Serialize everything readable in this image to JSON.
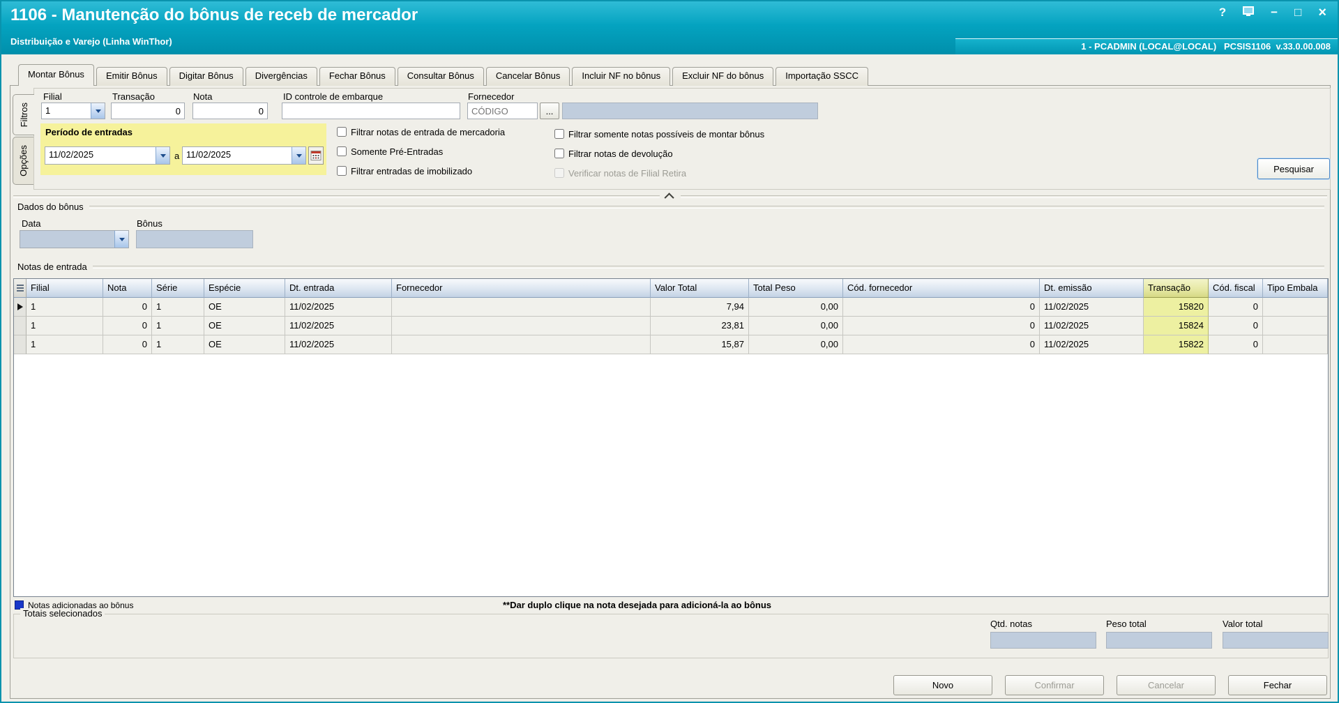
{
  "colors": {
    "titlebar_teal": "#04a3c0",
    "highlight_yellow": "#f6f29b",
    "transacao_yellow": "#edf0a1",
    "legend_blue": "#1837c8",
    "field_readonly_blue": "#c0cddd"
  },
  "window": {
    "title": "1106 - Manutenção do bônus de receb de mercador",
    "subtitle": "Distribuição e Varejo (Linha WinThor)",
    "user_info": "1 - PCADMIN (LOCAL@LOCAL)   PCSIS1106  v.33.0.00.008",
    "controls": {
      "help": "?",
      "minimize": "−",
      "maximize": "□",
      "close": "×"
    }
  },
  "tabs": [
    {
      "label": "Montar Bônus",
      "active": true
    },
    {
      "label": "Emitir Bônus",
      "active": false
    },
    {
      "label": "Digitar Bônus",
      "active": false
    },
    {
      "label": "Divergências",
      "active": false
    },
    {
      "label": "Fechar Bônus",
      "active": false
    },
    {
      "label": "Consultar Bônus",
      "active": false
    },
    {
      "label": "Cancelar Bônus",
      "active": false
    },
    {
      "label": "Incluir NF no bônus",
      "active": false
    },
    {
      "label": "Excluir NF do bônus",
      "active": false
    },
    {
      "label": "Importação SSCC",
      "active": false
    }
  ],
  "side_tabs": [
    {
      "label": "Filtros",
      "active": true
    },
    {
      "label": "Opções",
      "active": false
    }
  ],
  "filters": {
    "filial": {
      "label": "Filial",
      "value": "1"
    },
    "transacao": {
      "label": "Transação",
      "value": "0"
    },
    "nota": {
      "label": "Nota",
      "value": "0"
    },
    "id_embarque": {
      "label": "ID controle de embarque",
      "value": ""
    },
    "fornecedor": {
      "label": "Fornecedor",
      "code_placeholder": "CÓDIGO",
      "browse_label": "...",
      "name_value": ""
    },
    "periodo": {
      "label": "Período de entradas",
      "date_from": "11/02/2025",
      "connector": "a",
      "date_to": "11/02/2025"
    },
    "checkbox_groups": [
      {
        "items": [
          {
            "label": "Filtrar notas de entrada de mercadoria",
            "checked": false
          },
          {
            "label": "Somente Pré-Entradas",
            "checked": false
          },
          {
            "label": "Filtrar entradas de imobilizado",
            "checked": false
          }
        ]
      },
      {
        "items": [
          {
            "label": "Filtrar somente notas possíveis de montar bônus",
            "checked": false
          },
          {
            "label": "Filtrar notas de devolução",
            "checked": false
          },
          {
            "label": "Verificar notas de Filial Retira",
            "checked": false,
            "disabled": true
          }
        ]
      }
    ],
    "search_button": "Pesquisar"
  },
  "bonus_section": {
    "title": "Dados do bônus",
    "data_label": "Data",
    "data_value": "",
    "bonus_label": "Bônus",
    "bonus_value": ""
  },
  "notes": {
    "title": "Notas de entrada",
    "columns": [
      "Filial",
      "Nota",
      "Série",
      "Espécie",
      "Dt. entrada",
      "Fornecedor",
      "Valor Total",
      "Total Peso",
      "Cód. fornecedor",
      "Dt. emissão",
      "Transação",
      "Cód. fiscal",
      "Tipo Embala"
    ],
    "rows": [
      {
        "current": true,
        "cells": [
          "1",
          "0",
          "1",
          "OE",
          "11/02/2025",
          "",
          "7,94",
          "0,00",
          "0",
          "11/02/2025",
          "15820",
          "0",
          ""
        ]
      },
      {
        "current": false,
        "cells": [
          "1",
          "0",
          "1",
          "OE",
          "11/02/2025",
          "",
          "23,81",
          "0,00",
          "0",
          "11/02/2025",
          "15824",
          "0",
          ""
        ]
      },
      {
        "current": false,
        "cells": [
          "1",
          "0",
          "1",
          "OE",
          "11/02/2025",
          "",
          "15,87",
          "0,00",
          "0",
          "11/02/2025",
          "15822",
          "0",
          ""
        ]
      }
    ],
    "legend": "Notas adicionadas ao bônus",
    "hint": "**Dar duplo clique na nota desejada para adicioná-la ao bônus"
  },
  "totals": {
    "title": "Totais selecionados",
    "fields": [
      {
        "label": "Qtd. notas",
        "value": ""
      },
      {
        "label": "Peso total",
        "value": ""
      },
      {
        "label": "Valor total",
        "value": ""
      }
    ]
  },
  "footer_buttons": [
    {
      "label": "Novo",
      "enabled": true
    },
    {
      "label": "Confirmar",
      "enabled": false
    },
    {
      "label": "Cancelar",
      "enabled": false
    },
    {
      "label": "Fechar",
      "enabled": true
    }
  ]
}
